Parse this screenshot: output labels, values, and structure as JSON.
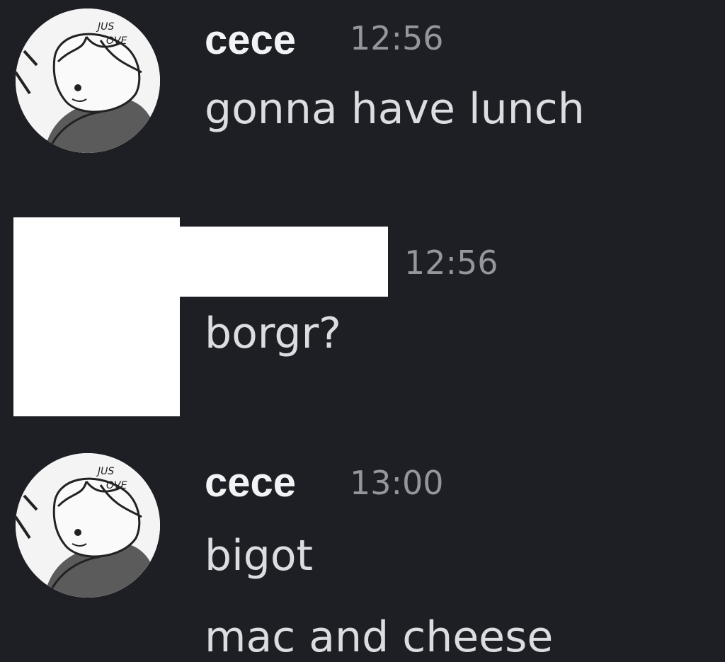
{
  "messages": [
    {
      "author": "cece",
      "timestamp": "12:56",
      "lines": [
        "gonna have lunch"
      ],
      "avatar": "manga-character-avatar",
      "avatar_text": [
        "JUS",
        "OVE"
      ]
    },
    {
      "author": "",
      "author_redacted": true,
      "timestamp": "12:56",
      "lines": [
        "borgr?"
      ],
      "avatar_redacted": true
    },
    {
      "author": "cece",
      "timestamp": "13:00",
      "lines": [
        "bigot",
        "mac and cheese"
      ],
      "avatar": "manga-character-avatar",
      "avatar_text": [
        "JUS",
        "OVE"
      ]
    }
  ],
  "colors": {
    "background": "#1e1f24",
    "username": "#f2f3f5",
    "timestamp": "#94959d",
    "message_text": "#dcdde1",
    "redaction": "#ffffff"
  }
}
